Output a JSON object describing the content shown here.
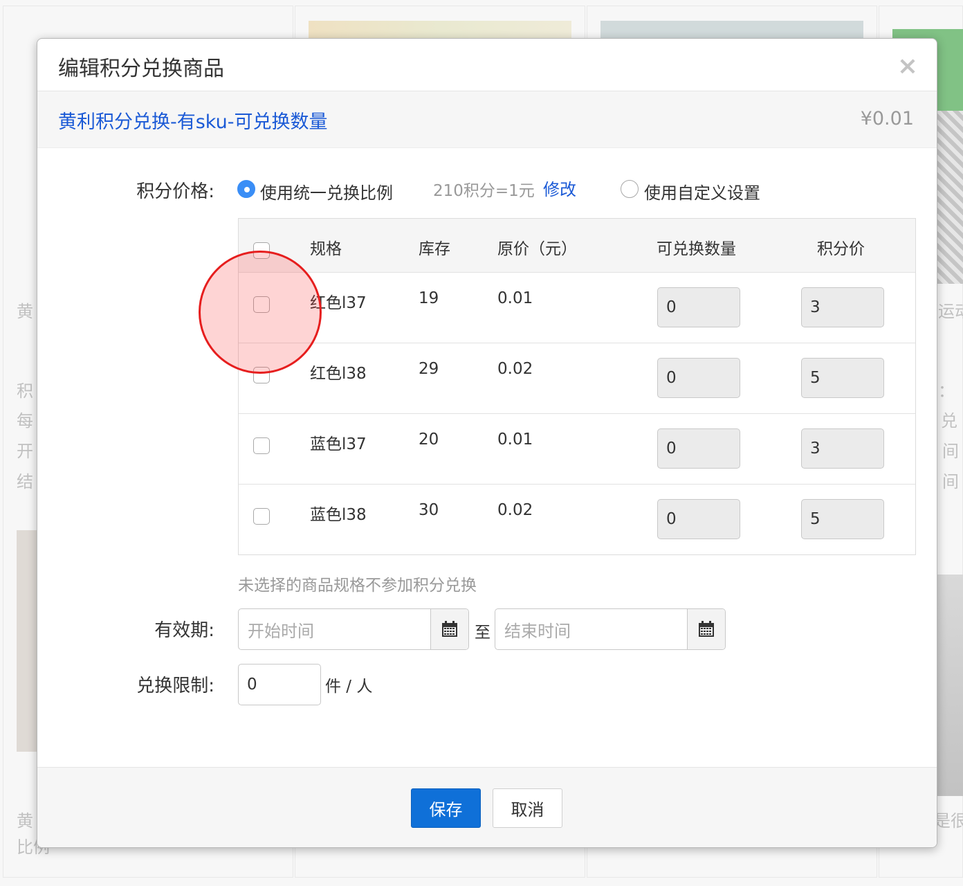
{
  "background": {
    "left_texts": [
      "黄",
      "积",
      "每",
      "开",
      "结",
      "黄",
      "比例"
    ],
    "right_texts": [
      "运动",
      "：",
      "兑",
      "间",
      "间",
      "是很"
    ]
  },
  "modal": {
    "title": "编辑积分兑换商品",
    "close_symbol": "×",
    "product": {
      "name": "黄利积分兑换-有sku-可兑换数量",
      "price": "¥0.01"
    },
    "points_price": {
      "label": "积分价格:",
      "option_unified": "使用统一兑换比例",
      "ratio": "210积分=1元",
      "modify_link": "修改",
      "option_custom": "使用自定义设置",
      "selected": "unified"
    },
    "table": {
      "headers": {
        "spec": "规格",
        "stock": "库存",
        "price": "原价（元）",
        "qty": "可兑换数量",
        "points": "积分价"
      },
      "rows": [
        {
          "spec": "红色l37",
          "stock": "19",
          "price": "0.01",
          "qty": "0",
          "points": "3"
        },
        {
          "spec": "红色l38",
          "stock": "29",
          "price": "0.02",
          "qty": "0",
          "points": "5"
        },
        {
          "spec": "蓝色l37",
          "stock": "20",
          "price": "0.01",
          "qty": "0",
          "points": "3"
        },
        {
          "spec": "蓝色l38",
          "stock": "30",
          "price": "0.02",
          "qty": "0",
          "points": "5"
        }
      ]
    },
    "hint": "未选择的商品规格不参加积分兑换",
    "validity": {
      "label": "有效期:",
      "start_placeholder": "开始时间",
      "to": "至",
      "end_placeholder": "结束时间"
    },
    "limit": {
      "label": "兑换限制:",
      "value": "0",
      "unit": "件 / 人"
    },
    "footer": {
      "save": "保存",
      "cancel": "取消"
    }
  },
  "colors": {
    "link_blue": "#1b5ad6",
    "primary_button": "#0f70d8",
    "radio_checked": "#3a8ef6",
    "click_marker": "#e61e1e"
  },
  "icons": {
    "close": "close-icon",
    "calendar": "calendar-icon"
  }
}
